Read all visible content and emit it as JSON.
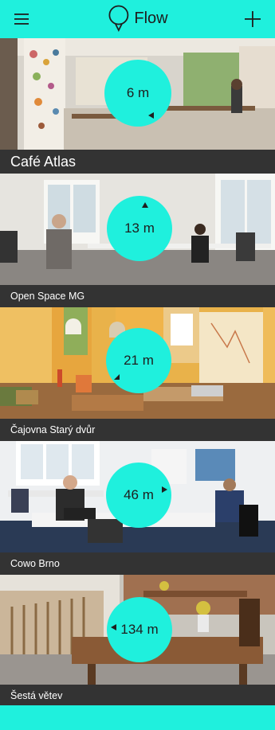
{
  "header": {
    "app_name": "Flow",
    "menu_icon": "hamburger-menu-icon",
    "logo_icon": "location-pin-icon",
    "add_icon": "plus-icon"
  },
  "colors": {
    "accent": "#1ff0dd",
    "caption_bg": "#333333",
    "caption_text": "#ffffff",
    "badge_text": "#1e1e1e"
  },
  "places": [
    {
      "name": "Café Atlas",
      "distance": "6 m"
    },
    {
      "name": "Open Space MG",
      "distance": "13 m"
    },
    {
      "name": "Čajovna Starý dvůr",
      "distance": "21 m"
    },
    {
      "name": "Cowo Brno",
      "distance": "46 m"
    },
    {
      "name": "Šestá větev",
      "distance": "134 m"
    }
  ]
}
